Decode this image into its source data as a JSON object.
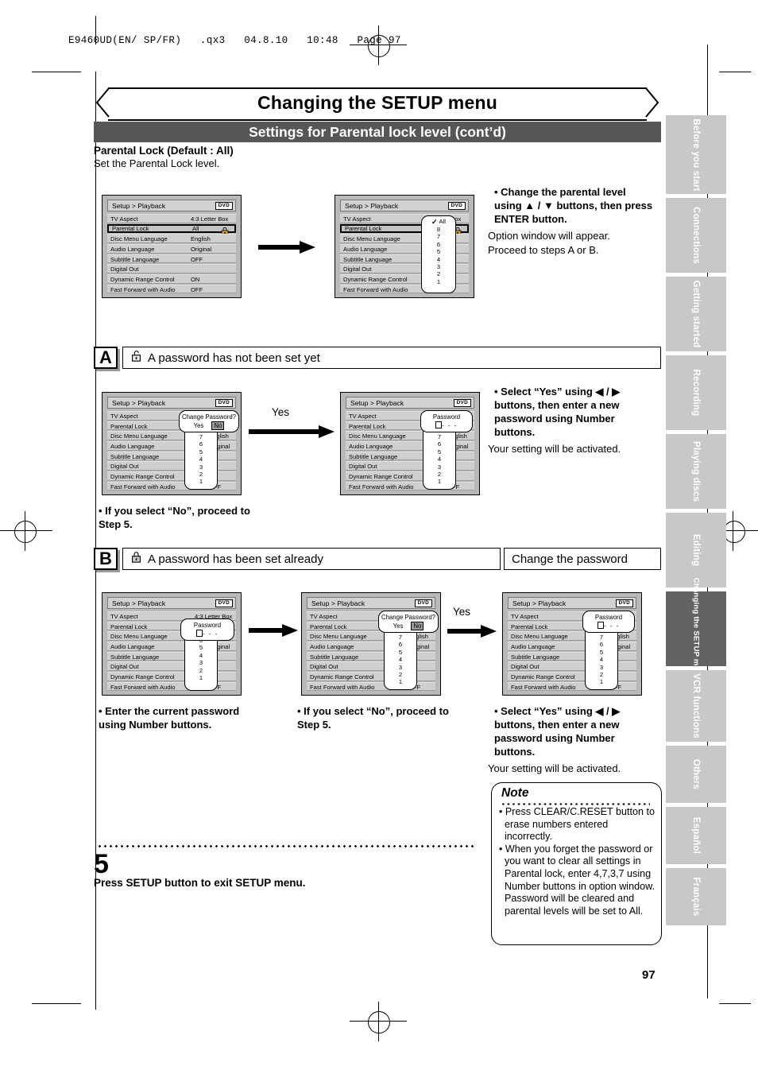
{
  "print_header": "E9460UD(EN/ SP/FR)   .qx3   04.8.10   10:48   Page 97",
  "title": "Changing the SETUP menu",
  "subtitle": "Settings for Parental lock level (cont’d)",
  "section_heading": "Parental Lock (Default : All)",
  "section_sub": "Set the Parental Lock level.",
  "page_number": "97",
  "menu": {
    "title": "Setup > Playback",
    "disc_badge": "DVD",
    "rows": [
      {
        "label": "TV Aspect",
        "value": "4:3 Letter Box"
      },
      {
        "label": "Parental Lock",
        "value": "All"
      },
      {
        "label": "Disc Menu Language",
        "value": "English"
      },
      {
        "label": "Audio Language",
        "value": "Original"
      },
      {
        "label": "Subtitle Language",
        "value": "OFF"
      },
      {
        "label": "Digital Out",
        "value": ""
      },
      {
        "label": "Dynamic Range Control",
        "value": "ON"
      },
      {
        "label": "Fast Forward with Audio",
        "value": "OFF"
      }
    ],
    "levels": [
      "All",
      "8",
      "7",
      "6",
      "5",
      "4",
      "3",
      "2",
      "1"
    ],
    "checked_level": "All",
    "dialog_change_password": {
      "title": "Change Password?",
      "yes": "Yes",
      "no": "No",
      "selected": "No"
    },
    "dialog_password": {
      "title": "Password",
      "value": "- - -"
    }
  },
  "step4": {
    "bullet_bold": "• Change the parental level using ▲ / ▼ buttons, then press ENTER button.",
    "line1": "Option window will appear.",
    "line2": "Proceed to steps A or B."
  },
  "section_a": {
    "letter": "A",
    "heading": "A password has not been set yet",
    "arrow_label": "Yes",
    "right_bullet": "• Select “Yes” using ◀ / ▶ buttons, then enter a new password using Number buttons.",
    "right_plain": "Your setting will be activated.",
    "left_note": "• If you select “No”, proceed to Step 5."
  },
  "section_b": {
    "letter": "B",
    "heading": "A password has been set already",
    "heading2": "Change the password",
    "arrow_label": "Yes",
    "caption1": "•  Enter the current password using Number buttons.",
    "caption2": "• If you select “No”, proceed to Step 5.",
    "caption3_bold": "• Select “Yes” using ◀ / ▶ buttons, then enter a new password using Number buttons.",
    "caption3_plain": "Your setting will be activated."
  },
  "step5": {
    "number": "5",
    "text": "Press SETUP button to exit SETUP menu."
  },
  "note": {
    "title": "Note",
    "items": [
      "• Press CLEAR/C.RESET button to erase numbers entered incorrectly.",
      "• When you forget the password or you want to clear all settings in Parental lock, enter 4,7,3,7 using Number buttons in option window. Password will be cleared and parental levels will be set to All."
    ]
  },
  "sidebar": {
    "tabs": [
      {
        "label": "Before you start",
        "active": false
      },
      {
        "label": "Connections",
        "active": false
      },
      {
        "label": "Getting started",
        "active": false
      },
      {
        "label": "Recording",
        "active": false
      },
      {
        "label": "Playing discs",
        "active": false
      },
      {
        "label": "Editing",
        "active": false
      },
      {
        "label": "Changing the SETUP menu",
        "active": true
      },
      {
        "label": "VCR functions",
        "active": false
      },
      {
        "label": "Others",
        "active": false
      },
      {
        "label": "Español",
        "active": false
      },
      {
        "label": "Français",
        "active": false
      }
    ]
  }
}
